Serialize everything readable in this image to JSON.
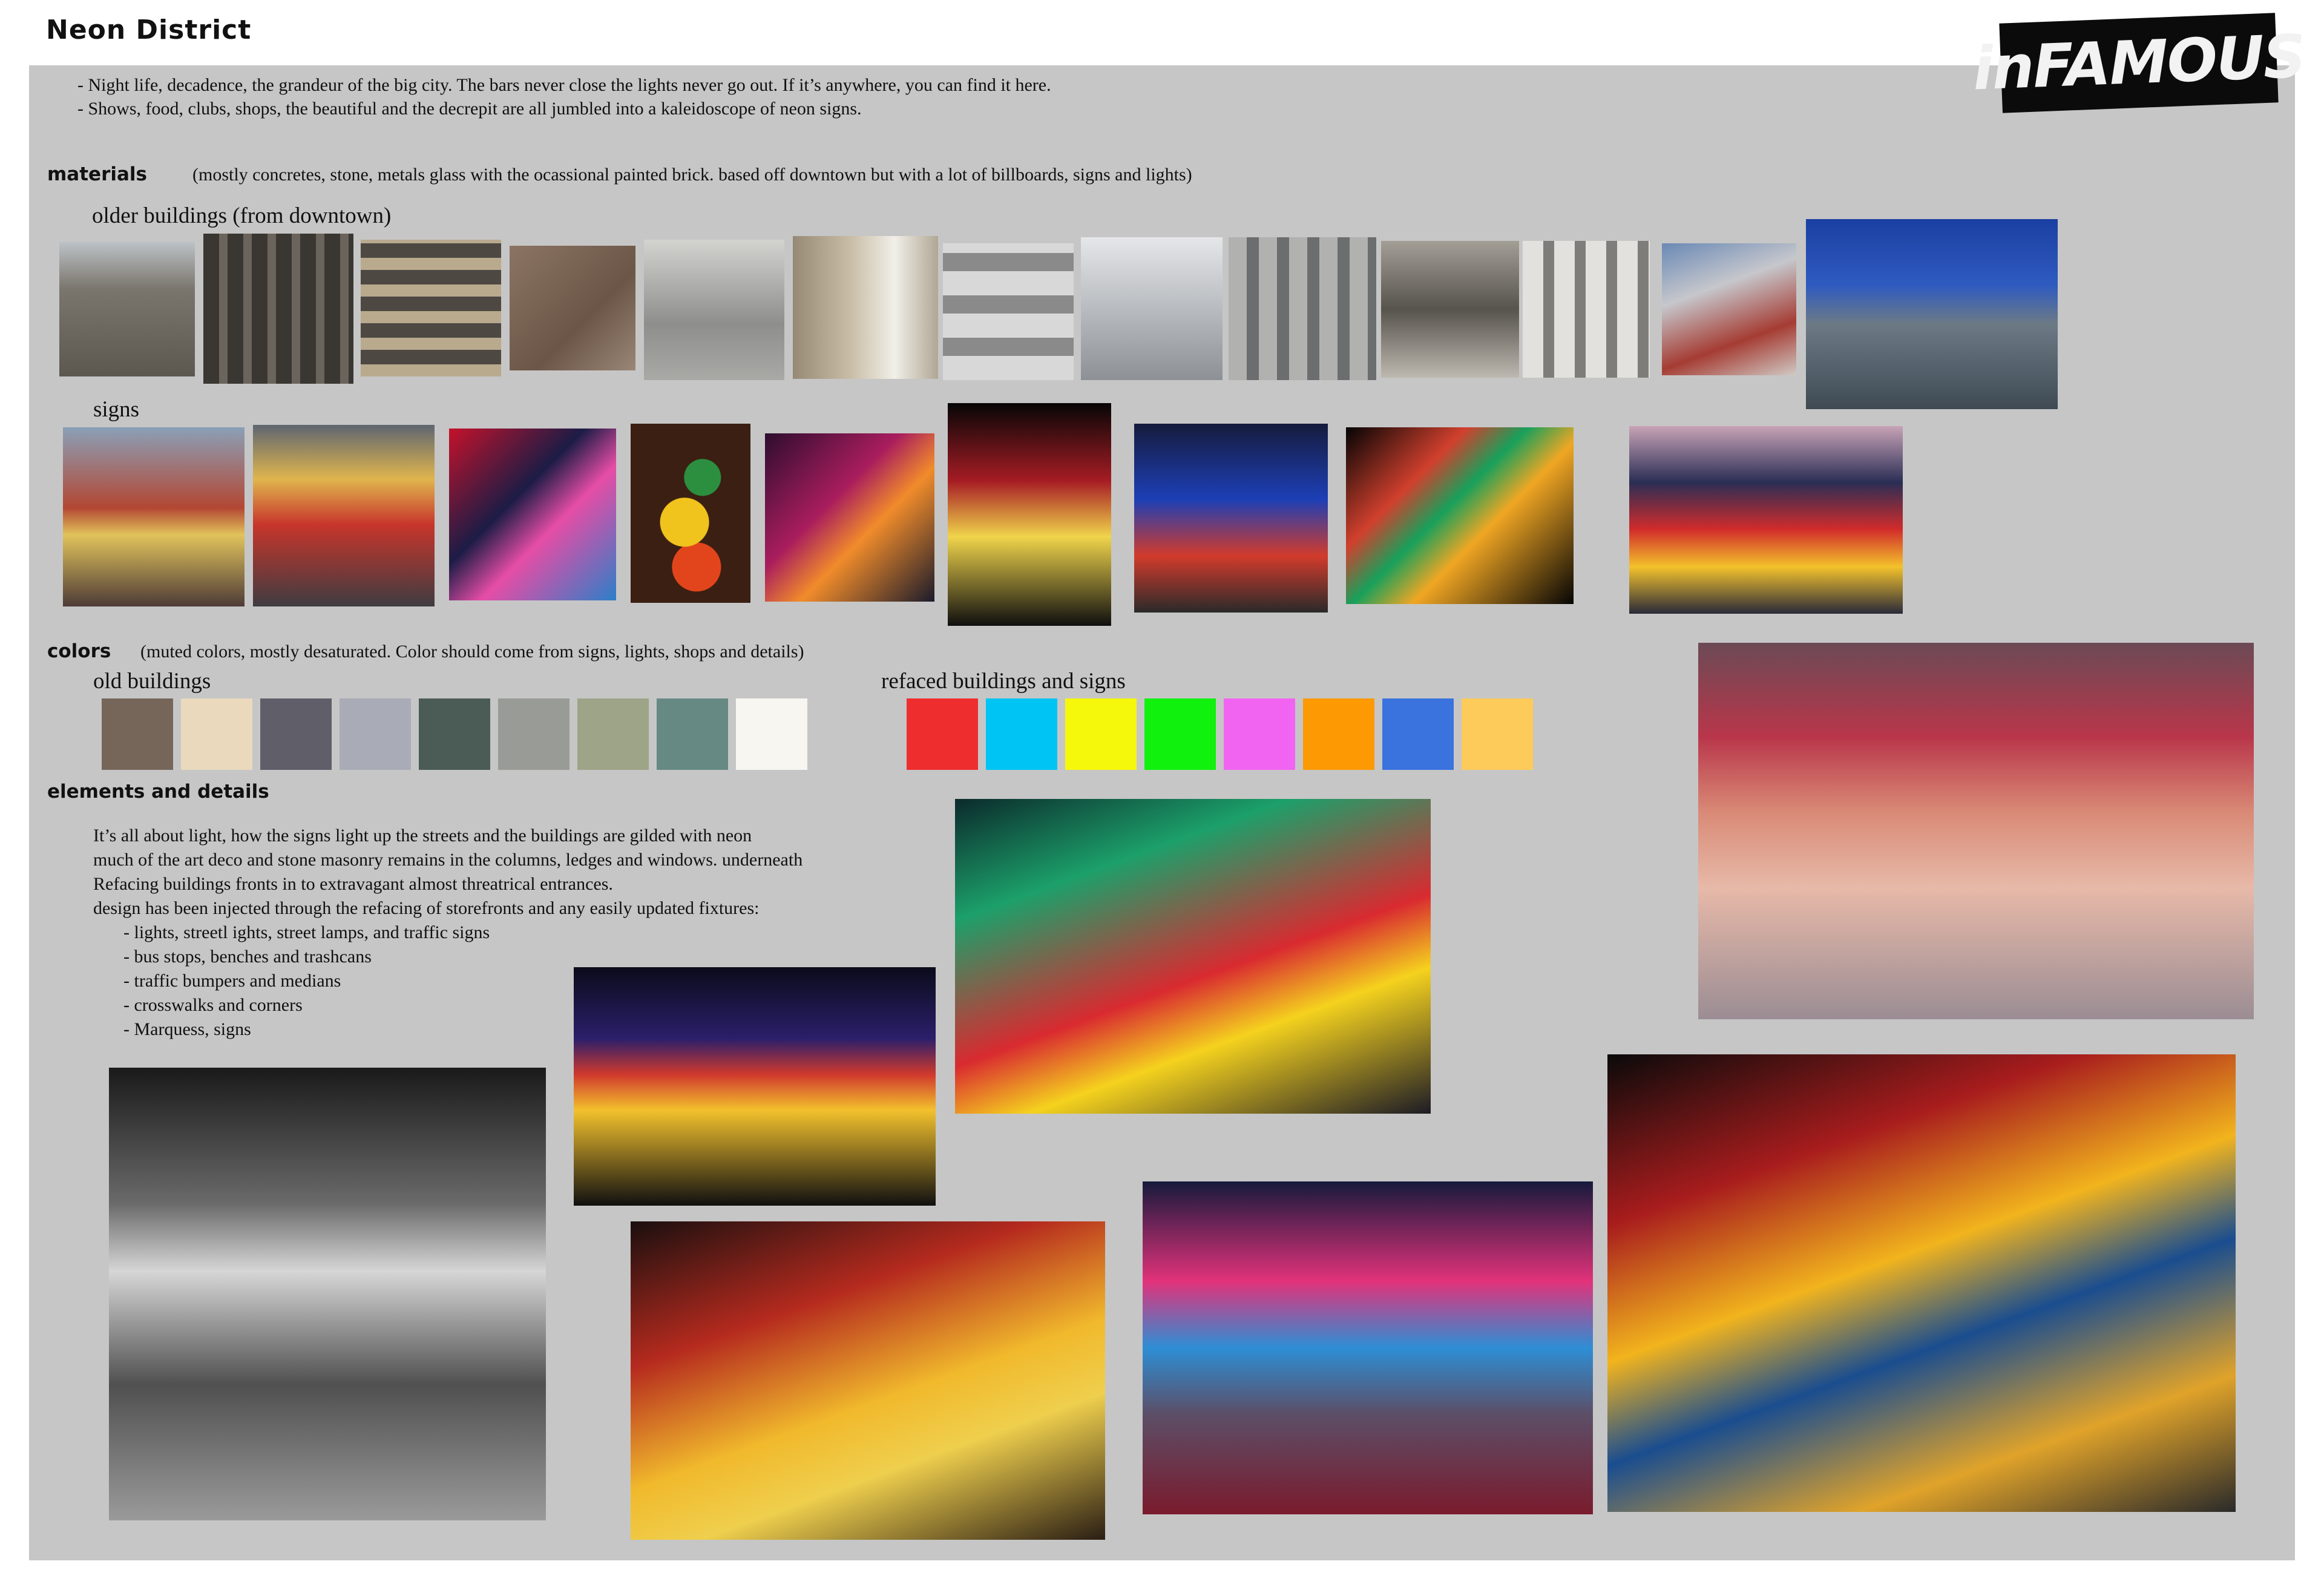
{
  "title": "Neon District",
  "logo_text": "inFAMOUS",
  "intro": [
    "-  Night life, decadence, the grandeur of the big city.  The bars never close the lights never go out.  If it’s anywhere, you can find it here.",
    "-  Shows, food, clubs, shops, the beautiful and the decrepit are all jumbled into a kaleidoscope of neon signs."
  ],
  "materials": {
    "heading": "materials",
    "note": "(mostly concretes, stone, metals  glass with the ocassional painted brick.  based off downtown but with a lot of billboards, signs and lights)",
    "older_label": "older buildings (from downtown)",
    "signs_label": "signs"
  },
  "colors": {
    "heading": "colors",
    "note": "(muted colors, mostly desaturated.  Color should come from signs, lights, shops and details)",
    "old_label": "old buildings",
    "old_swatches": [
      "#76665a",
      "#ead9bd",
      "#5f5e69",
      "#a9abb6",
      "#4b5b55",
      "#999b96",
      "#9ea487",
      "#668983",
      "#f7f6f1"
    ],
    "refaced_label": "refaced buildings and signs",
    "refaced_swatches": [
      "#ee2d2e",
      "#00c4f4",
      "#f6f80c",
      "#10f10d",
      "#f164f1",
      "#fc9903",
      "#3a72de",
      "#fdcb5a"
    ]
  },
  "elements": {
    "heading": "elements and details",
    "lines": [
      "It’s all about light, how the signs light up the streets and the buildings are gilded with neon",
      "much of the art deco and stone masonry remains in the columns, ledges and windows. underneath",
      "Refacing buildings fronts in to extravagant almost threatrical entrances.",
      "design has been injected through the refacing of storefronts and any easily updated fixtures:"
    ],
    "bullets": [
      "-   lights, streetl ights, street lamps, and traffic signs",
      "-   bus stops, benches and trashcans",
      "-   traffic bumpers and medians",
      "-   crosswalks and corners",
      "-   Marquess, signs"
    ]
  }
}
